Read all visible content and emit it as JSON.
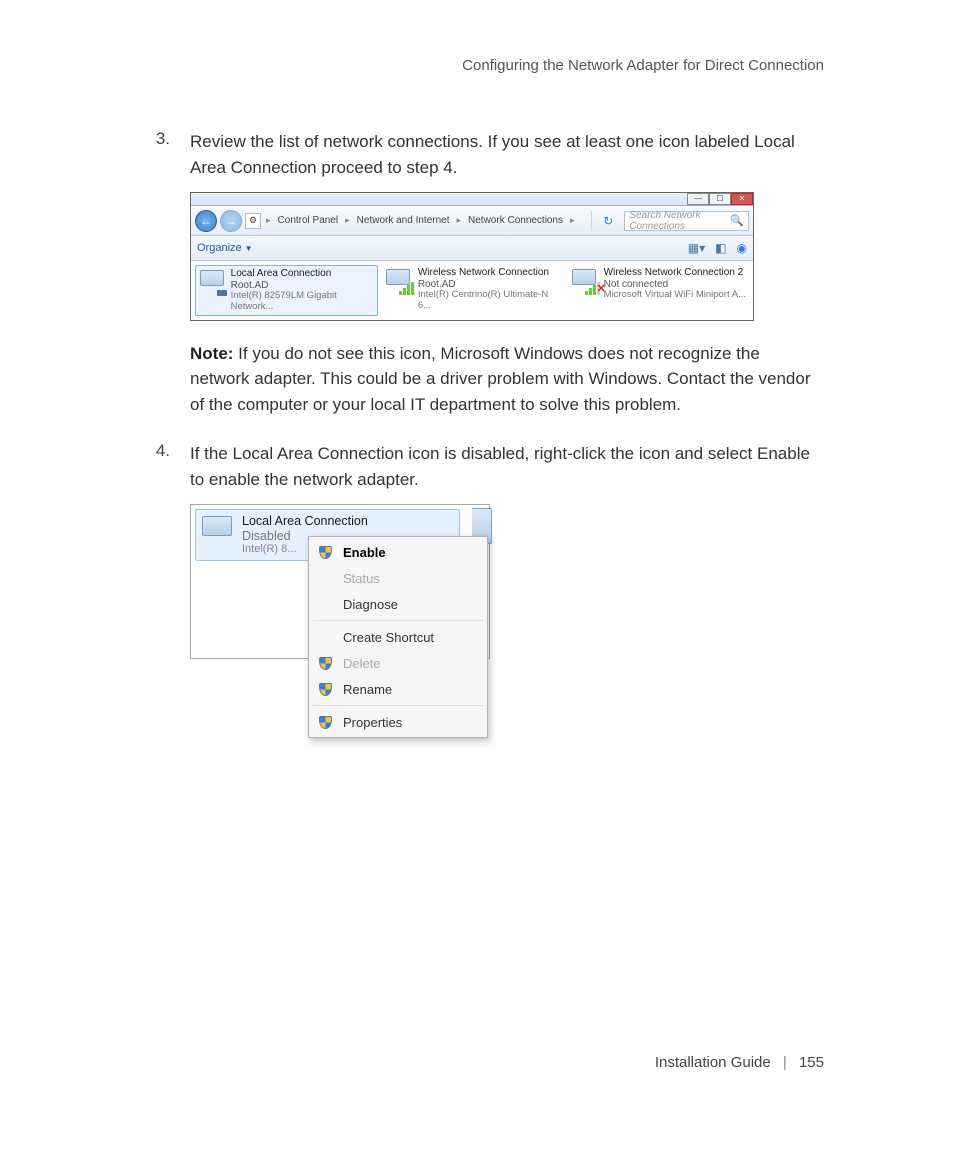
{
  "header": "Configuring the Network Adapter for Direct Connection",
  "steps": {
    "s3": {
      "num": "3.",
      "text": "Review the list of network connections. If you see at least one icon labeled Local Area Connection proceed to step 4."
    },
    "note_label": "Note:",
    "note_text": "  If you do not see this icon, Microsoft Windows does not recognize the network adapter. This could be a driver problem with Windows. Contact the vendor of the computer or your local IT department to solve this problem.",
    "s4": {
      "num": "4.",
      "text": "If the Local Area Connection icon is disabled, right-click the icon and select Enable to enable the network adapter."
    }
  },
  "screenA": {
    "breadcrumb": {
      "a": "Control Panel",
      "b": "Network and Internet",
      "c": "Network Connections"
    },
    "search_placeholder": "Search Network Connections",
    "organize": "Organize",
    "conns": [
      {
        "title": "Local Area Connection",
        "line2": "Root.AD",
        "line3": "Intel(R) 82579LM Gigabit Network..."
      },
      {
        "title": "Wireless Network Connection",
        "line2": "Root.AD",
        "line3": "Intel(R) Centrino(R) Ultimate-N 6..."
      },
      {
        "title": "Wireless Network Connection 2",
        "line2": "Not connected",
        "line3": "Microsoft Virtual WiFi Miniport A..."
      }
    ]
  },
  "screenB": {
    "item": {
      "title": "Local Area Connection",
      "line2": "Disabled",
      "line3": "Intel(R) 8..."
    },
    "menu": {
      "enable": "Enable",
      "status": "Status",
      "diagnose": "Diagnose",
      "create_shortcut": "Create Shortcut",
      "delete": "Delete",
      "rename": "Rename",
      "properties": "Properties"
    }
  },
  "footer": {
    "guide": "Installation Guide",
    "page": "155"
  }
}
